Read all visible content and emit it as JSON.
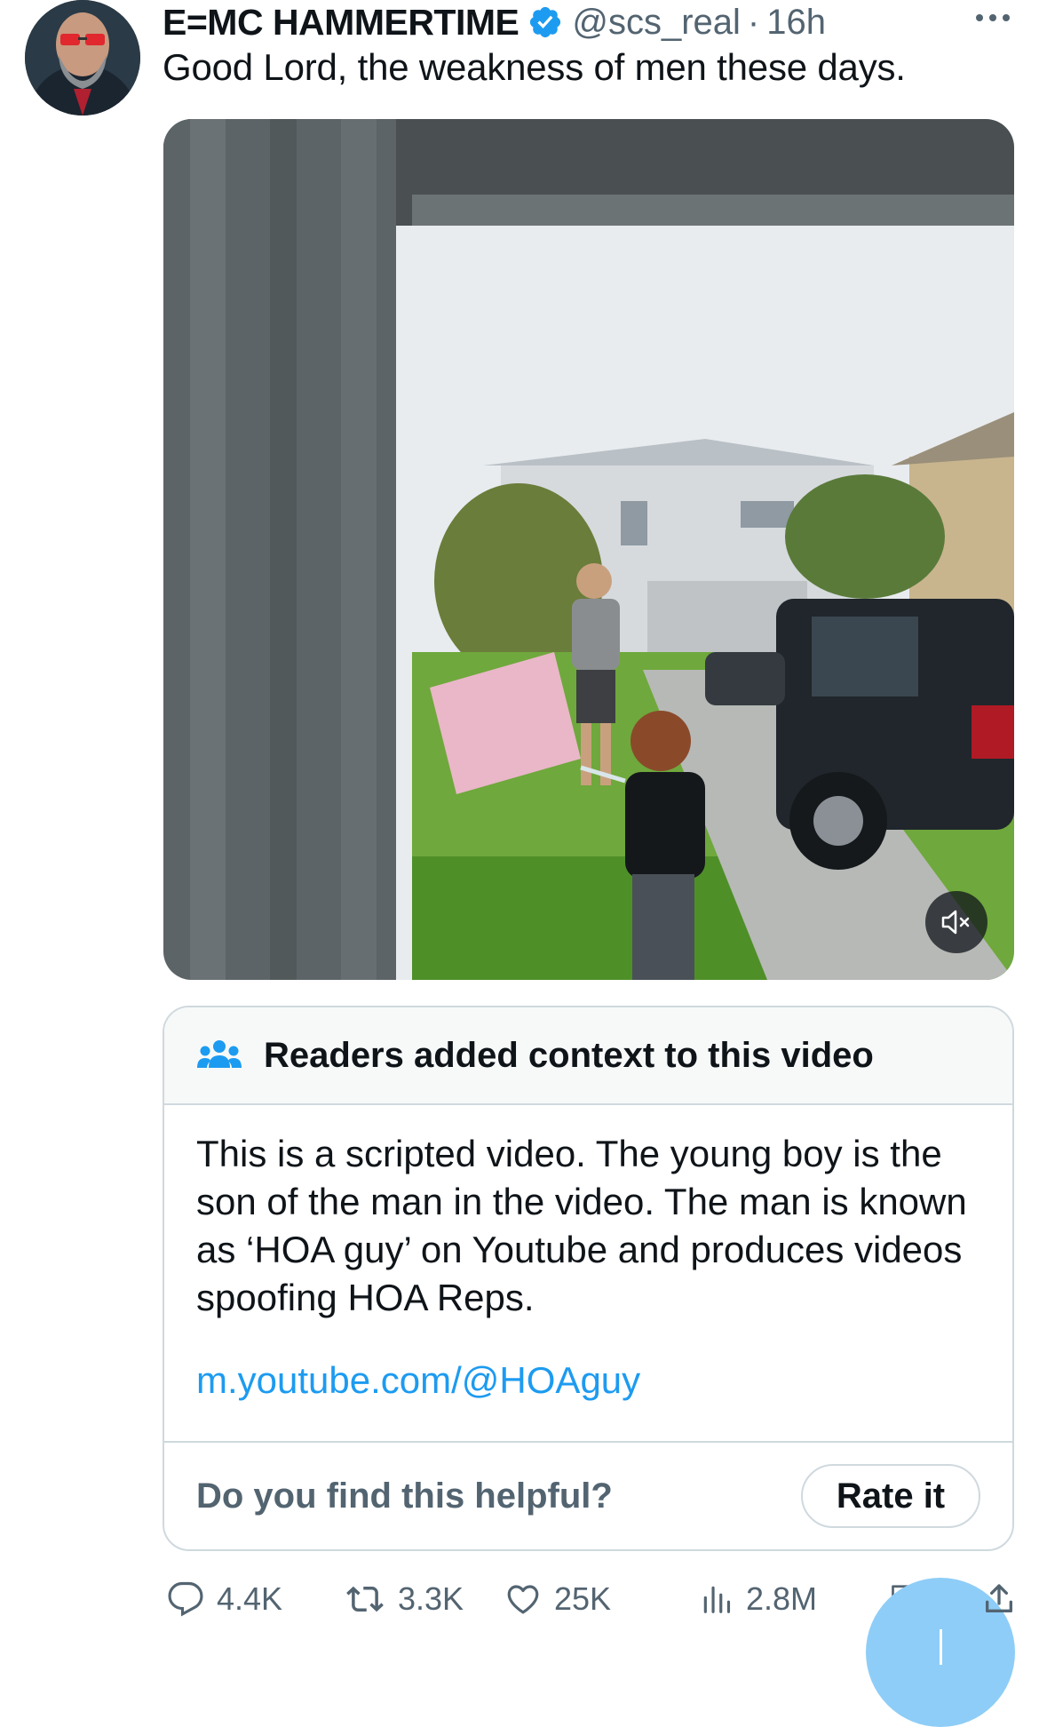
{
  "post": {
    "author_name": "E=MC HAMMERTIME",
    "handle": "@scs_real",
    "separator": "·",
    "time": "16h",
    "text": "Good Lord, the weakness of men these days."
  },
  "note": {
    "title": "Readers added context to this video",
    "text": "This is a scripted video. The young boy is the son of the man in the video. The man is known as ‘HOA guy’ on Youtube and produces videos spoofing HOA Reps.",
    "link": "m.youtube.com/@HOAguy",
    "question": "Do you find this helpful?",
    "rate_label": "Rate it"
  },
  "actions": {
    "replies": "4.4K",
    "reposts": "3.3K",
    "likes": "25K",
    "views": "2.8M"
  },
  "icons": {
    "verified": "verified-badge-icon",
    "more": "more-icon",
    "mute": "mute-icon",
    "people": "people-icon",
    "reply": "reply-icon",
    "repost": "repost-icon",
    "like": "heart-icon",
    "views": "views-icon",
    "bookmark": "bookmark-icon",
    "share": "share-icon"
  },
  "colors": {
    "accent": "#1d9bf0",
    "text": "#0f1419",
    "secondary": "#536471",
    "border": "#cfd9de"
  }
}
